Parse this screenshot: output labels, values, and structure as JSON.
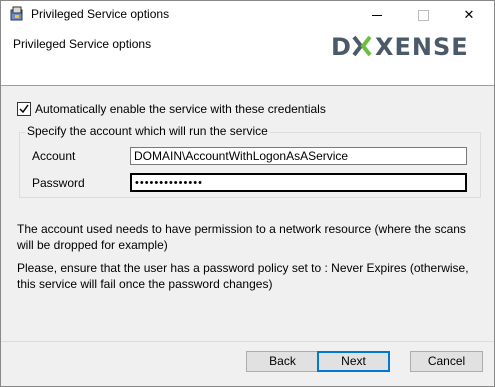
{
  "window": {
    "title": "Privileged Service options",
    "header_subtitle": "Privileged Service options",
    "logo_text": "DOXENSE",
    "brand_colors": {
      "gray": "#4a5a68",
      "green": "#6cbf3e"
    }
  },
  "form": {
    "auto_enable_label": "Automatically enable the service with these credentials",
    "auto_enable_checked": true,
    "group_legend": "Specify the account which will run the service",
    "account_label": "Account",
    "account_value": "DOMAIN\\AccountWithLogonAsAService",
    "password_label": "Password",
    "password_masked": "••••••••••••••"
  },
  "notes": {
    "permission_note": "The account used needs to have permission to a network resource (where the scans will be dropped for example)",
    "policy_note": "Please, ensure that the user has a password policy set to : Never Expires (otherwise, this service will fail once the password changes)"
  },
  "buttons": {
    "back": "Back",
    "next": "Next",
    "cancel": "Cancel"
  }
}
